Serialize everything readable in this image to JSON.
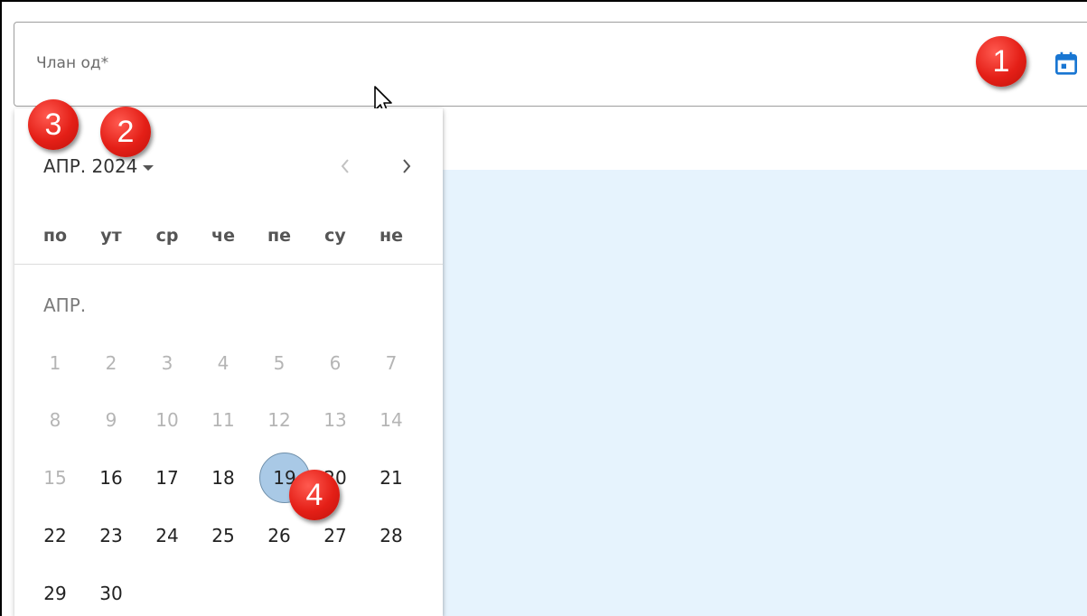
{
  "field": {
    "label": "Члан од*"
  },
  "calendar": {
    "month_year": "АПР. 2024",
    "month_label": "АПР.",
    "weekdays": [
      "по",
      "ут",
      "ср",
      "че",
      "пе",
      "су",
      "не"
    ],
    "days": {
      "d1": "1",
      "d2": "2",
      "d3": "3",
      "d4": "4",
      "d5": "5",
      "d6": "6",
      "d7": "7",
      "d8": "8",
      "d9": "9",
      "d10": "10",
      "d11": "11",
      "d12": "12",
      "d13": "13",
      "d14": "14",
      "d15": "15",
      "d16": "16",
      "d17": "17",
      "d18": "18",
      "d19": "19",
      "d20": "20",
      "d21": "21",
      "d22": "22",
      "d23": "23",
      "d24": "24",
      "d25": "25",
      "d26": "26",
      "d27": "27",
      "d28": "28",
      "d29": "29",
      "d30": "30"
    },
    "selected_day": "19",
    "icons": {
      "open": "calendar-icon",
      "prev": "chevron-left-icon",
      "next": "chevron-right-icon",
      "dropdown": "caret-down-icon"
    }
  },
  "annotations": {
    "a1": "1",
    "a2": "2",
    "a3": "3",
    "a4": "4"
  },
  "colors": {
    "accent": "#1976d2",
    "selected_day": "#a9c9e6",
    "panel_bg": "#e6f3fd",
    "badge": "#e41f17"
  }
}
